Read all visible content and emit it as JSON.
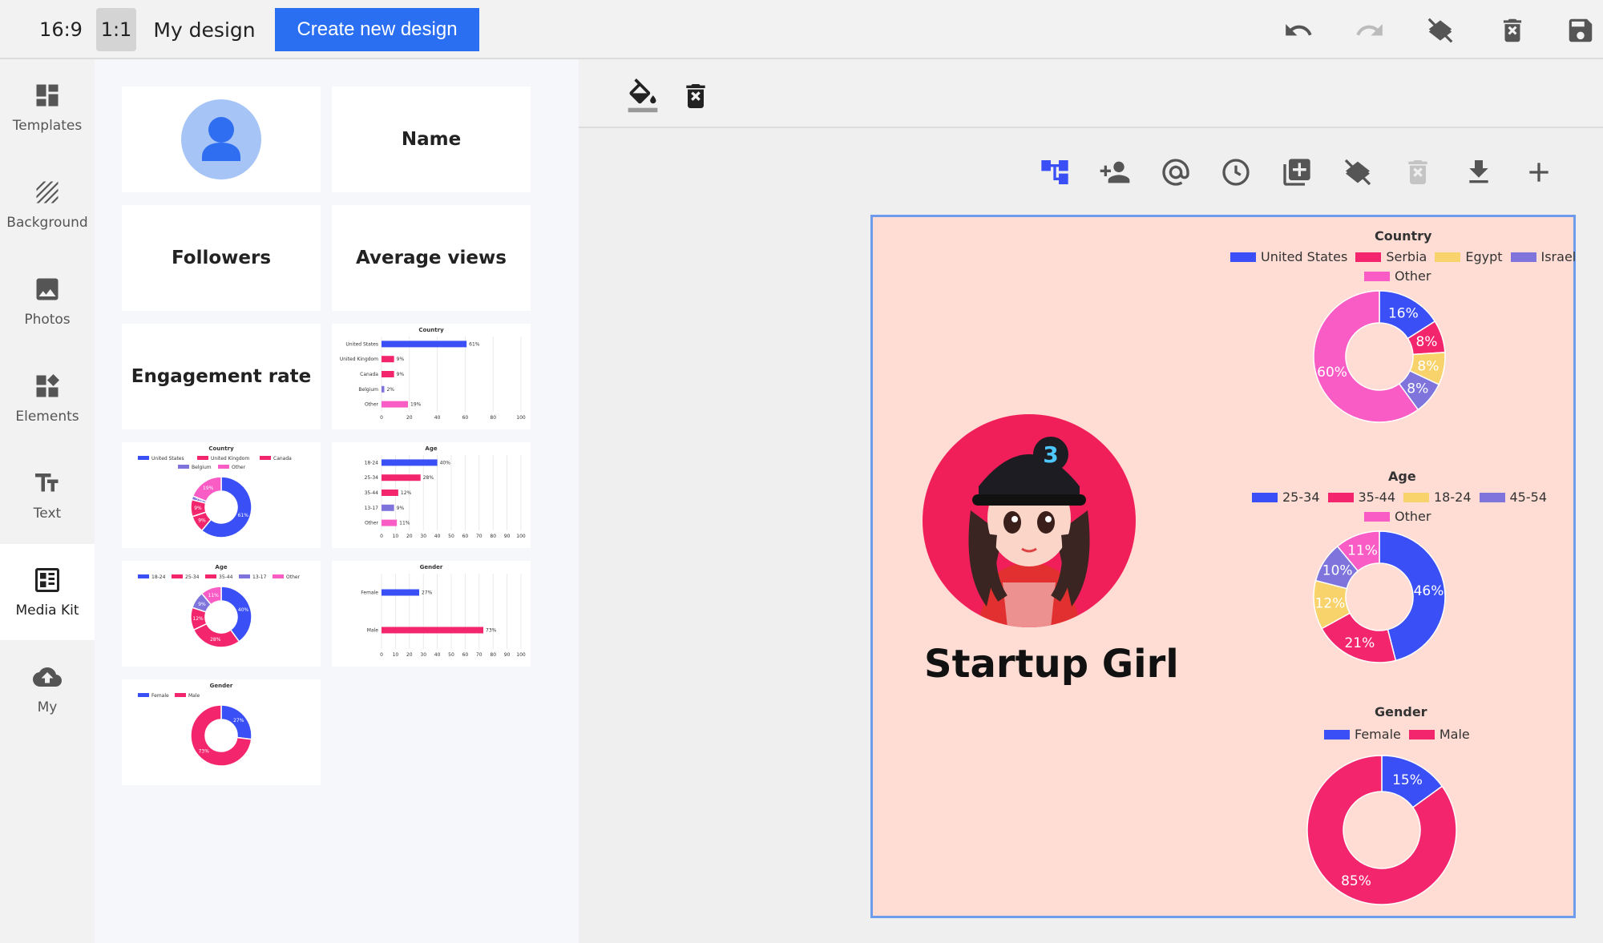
{
  "topbar": {
    "ratio_16_9": "16:9",
    "ratio_1_1": "1:1",
    "my_design": "My design",
    "create_button": "Create new design",
    "icons": [
      "undo-icon",
      "redo-icon",
      "layers-clear-icon",
      "delete-icon",
      "save-icon"
    ]
  },
  "sidebar": {
    "items": [
      {
        "label": "Templates",
        "icon": "templates-icon"
      },
      {
        "label": "Background",
        "icon": "background-icon"
      },
      {
        "label": "Photos",
        "icon": "photos-icon"
      },
      {
        "label": "Elements",
        "icon": "elements-icon"
      },
      {
        "label": "Text",
        "icon": "text-icon"
      },
      {
        "label": "Media Kit",
        "icon": "media-kit-icon",
        "active": true
      },
      {
        "label": "My",
        "icon": "cloud-upload-icon"
      }
    ]
  },
  "panel": {
    "name": "Name",
    "followers": "Followers",
    "average_views": "Average views",
    "engagement_rate": "Engagement rate",
    "country_bar": {
      "title": "Country",
      "categories": [
        "United States",
        "United Kingdom",
        "Canada",
        "Belgium",
        "Other"
      ],
      "values": [
        61,
        9,
        9,
        2,
        19
      ],
      "labels": [
        "61%",
        "9%",
        "9%",
        "2%",
        "19%"
      ],
      "ticks": [
        "0",
        "20",
        "40",
        "60",
        "80",
        "100"
      ]
    },
    "country_donut": {
      "title": "Country",
      "legend": [
        "United States",
        "United Kingdom",
        "Canada",
        "Belgium",
        "Other"
      ],
      "values": [
        61,
        9,
        9,
        2,
        19
      ],
      "labels": [
        "61%",
        "9%",
        "9%",
        "2%",
        "19%"
      ]
    },
    "age_bar": {
      "title": "Age",
      "categories": [
        "18-24",
        "25-34",
        "35-44",
        "13-17",
        "Other"
      ],
      "values": [
        40,
        28,
        12,
        9,
        11
      ],
      "labels": [
        "40%",
        "28%",
        "12%",
        "9%",
        "11%"
      ],
      "ticks": [
        "0",
        "10",
        "20",
        "30",
        "40",
        "50",
        "60",
        "70",
        "80",
        "90",
        "100"
      ]
    },
    "age_donut": {
      "title": "Age",
      "legend": [
        "18-24",
        "25-34",
        "35-44",
        "13-17",
        "Other"
      ],
      "values": [
        40,
        28,
        12,
        9,
        11
      ],
      "labels": [
        "40%",
        "28%",
        "12%",
        "9%",
        "11%"
      ]
    },
    "gender_bar": {
      "title": "Gender",
      "categories": [
        "Female",
        "Male"
      ],
      "values": [
        27,
        73
      ],
      "labels": [
        "27%",
        "73%"
      ],
      "ticks": [
        "0",
        "10",
        "20",
        "30",
        "40",
        "50",
        "60",
        "70",
        "80",
        "90",
        "100"
      ]
    },
    "gender_donut": {
      "title": "Gender",
      "legend": [
        "Female",
        "Male"
      ],
      "values": [
        27,
        73
      ],
      "labels": [
        "27%",
        "73%"
      ]
    }
  },
  "workspace": {
    "toolbar_icons": [
      "fill-color-icon",
      "delete-icon"
    ],
    "element_icons": [
      "hierarchy-icon",
      "person-add-icon",
      "at-icon",
      "clock-icon",
      "add-box-icon",
      "layers-clear-icon",
      "delete-disabled-icon",
      "download-icon",
      "plus-icon"
    ]
  },
  "canvas": {
    "title": "Startup Girl",
    "country": {
      "title": "Country",
      "legend": [
        "United States",
        "Serbia",
        "Egypt",
        "Israel",
        "Other"
      ],
      "values": [
        16,
        8,
        8,
        8,
        60
      ],
      "labels": [
        "16%",
        "8%",
        "8%",
        "8%",
        "60%"
      ]
    },
    "age": {
      "title": "Age",
      "legend": [
        "25-34",
        "35-44",
        "18-24",
        "45-54",
        "Other"
      ],
      "values": [
        46,
        21,
        12,
        10,
        11
      ],
      "labels": [
        "46%",
        "21%",
        "12%",
        "10%",
        "11%"
      ]
    },
    "gender": {
      "title": "Gender",
      "legend": [
        "Female",
        "Male"
      ],
      "values": [
        15,
        85
      ],
      "labels": [
        "15%",
        "85%"
      ]
    }
  },
  "chart_data": [
    {
      "type": "pie",
      "title": "Country",
      "categories": [
        "United States",
        "Serbia",
        "Egypt",
        "Israel",
        "Other"
      ],
      "values": [
        16,
        8,
        8,
        8,
        60
      ]
    },
    {
      "type": "pie",
      "title": "Age",
      "categories": [
        "25-34",
        "35-44",
        "18-24",
        "45-54",
        "Other"
      ],
      "values": [
        46,
        21,
        12,
        10,
        11
      ]
    },
    {
      "type": "pie",
      "title": "Gender",
      "categories": [
        "Female",
        "Male"
      ],
      "values": [
        15,
        85
      ]
    }
  ],
  "colors": {
    "blue": "#3a4ff5",
    "pink": "#f3266d",
    "yellow": "#f8d26a",
    "purple": "#7f74dc",
    "magenta": "#fa5cc5",
    "accent": "#2a6ff2",
    "canvas_bg": "#ffddd4"
  }
}
